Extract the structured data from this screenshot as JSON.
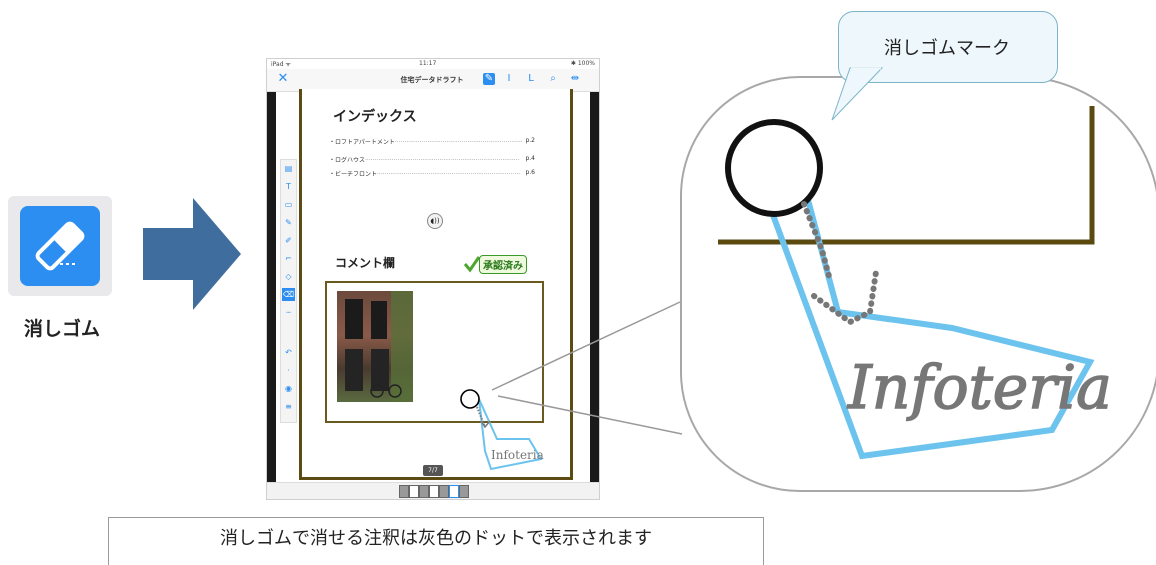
{
  "tool": {
    "label": "消しゴム",
    "icon": "eraser-icon",
    "color": "#2b8ef0"
  },
  "ipad": {
    "status_left": "iPad ᯤ",
    "status_time": "11:17",
    "status_right": "✱ 100%",
    "doc_title": "住宅データドラフト",
    "page_indicator": "7/7",
    "document": {
      "index_title": "インデックス",
      "index_items": [
        {
          "label": "・ロフトアパートメント",
          "page": "p.2"
        },
        {
          "label": "・ログハウス",
          "page": "p.4"
        },
        {
          "label": "・ビーチフロント",
          "page": "p.6"
        }
      ],
      "comment_title": "コメント欄",
      "approved_stamp": "承認済み",
      "annotation_text": "Infoteria"
    }
  },
  "zoom": {
    "callout_label": "消しゴムマーク",
    "annotation_text": "Infoteria",
    "dot_color": "#777777",
    "highlight_color": "#6cc3ee"
  },
  "caption": "消しゴムで消せる注釈は灰色のドットで表示されます"
}
